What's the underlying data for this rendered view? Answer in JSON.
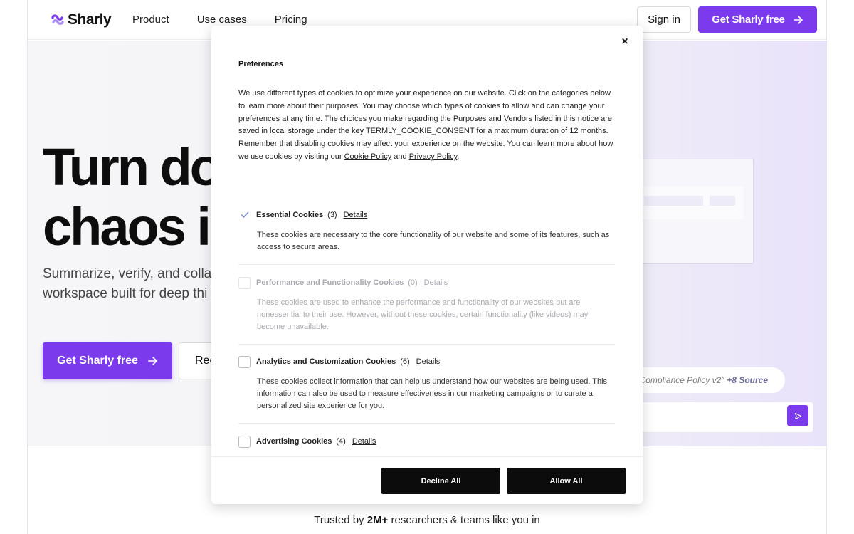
{
  "brand": {
    "name": "Sharly",
    "accent": "#7c3aed"
  },
  "nav": {
    "items": [
      "Product",
      "Use cases",
      "Pricing"
    ]
  },
  "header": {
    "signin": "Sign in",
    "cta": "Get Sharly free"
  },
  "hero": {
    "title": "Turn doc\nchaos in",
    "subtitle": "Summarize, verify, and colla\nworkspace built for deep thi",
    "cta": "Get Sharly free",
    "cta2": "Rec"
  },
  "mock": {
    "chip_text": "“Compliance Policy v2”",
    "chip_bold": "+8 Source"
  },
  "trusted": {
    "prefix": "Trusted by ",
    "bold": "2M+",
    "suffix": " researchers & teams like you in"
  },
  "modal": {
    "title": "Preferences",
    "description": "We use different types of cookies to optimize your experience on our website. Click on the categories below to learn more about their purposes. You may choose which types of cookies to allow and can change your preferences at any time. The choices you make regarding the Purposes and Vendors listed in this notice are saved in local storage under the key TERMLY_COOKIE_CONSENT for a maximum duration of 12 months. Remember that disabling cookies may affect your experience on the website. You can learn more about how we use cookies by visiting our ",
    "cookie_policy": "Cookie Policy",
    "and": " and ",
    "privacy_policy": "Privacy Policy",
    "period": ".",
    "details_label": "Details",
    "categories": [
      {
        "name": "Essential Cookies",
        "count": "(3)",
        "checked": true,
        "body": "These cookies are necessary to the core functionality of our website and some of its features, such as access to secure areas."
      },
      {
        "name": "Performance and Functionality Cookies",
        "count": "(0)",
        "checked": false,
        "body": "These cookies are used to enhance the performance and functionality of our websites but are nonessential to their use. However, without these cookies, certain functionality (like videos) may become unavailable."
      },
      {
        "name": "Analytics and Customization Cookies",
        "count": "(6)",
        "checked": false,
        "body": "These cookies collect information that can help us understand how our websites are being used. This information can also be used to measure effectiveness in our marketing campaigns or to curate a personalized site experience for you."
      },
      {
        "name": "Advertising Cookies",
        "count": "(4)",
        "checked": false,
        "body": ""
      }
    ],
    "decline": "Decline All",
    "allow": "Allow All",
    "close_icon": "×"
  }
}
